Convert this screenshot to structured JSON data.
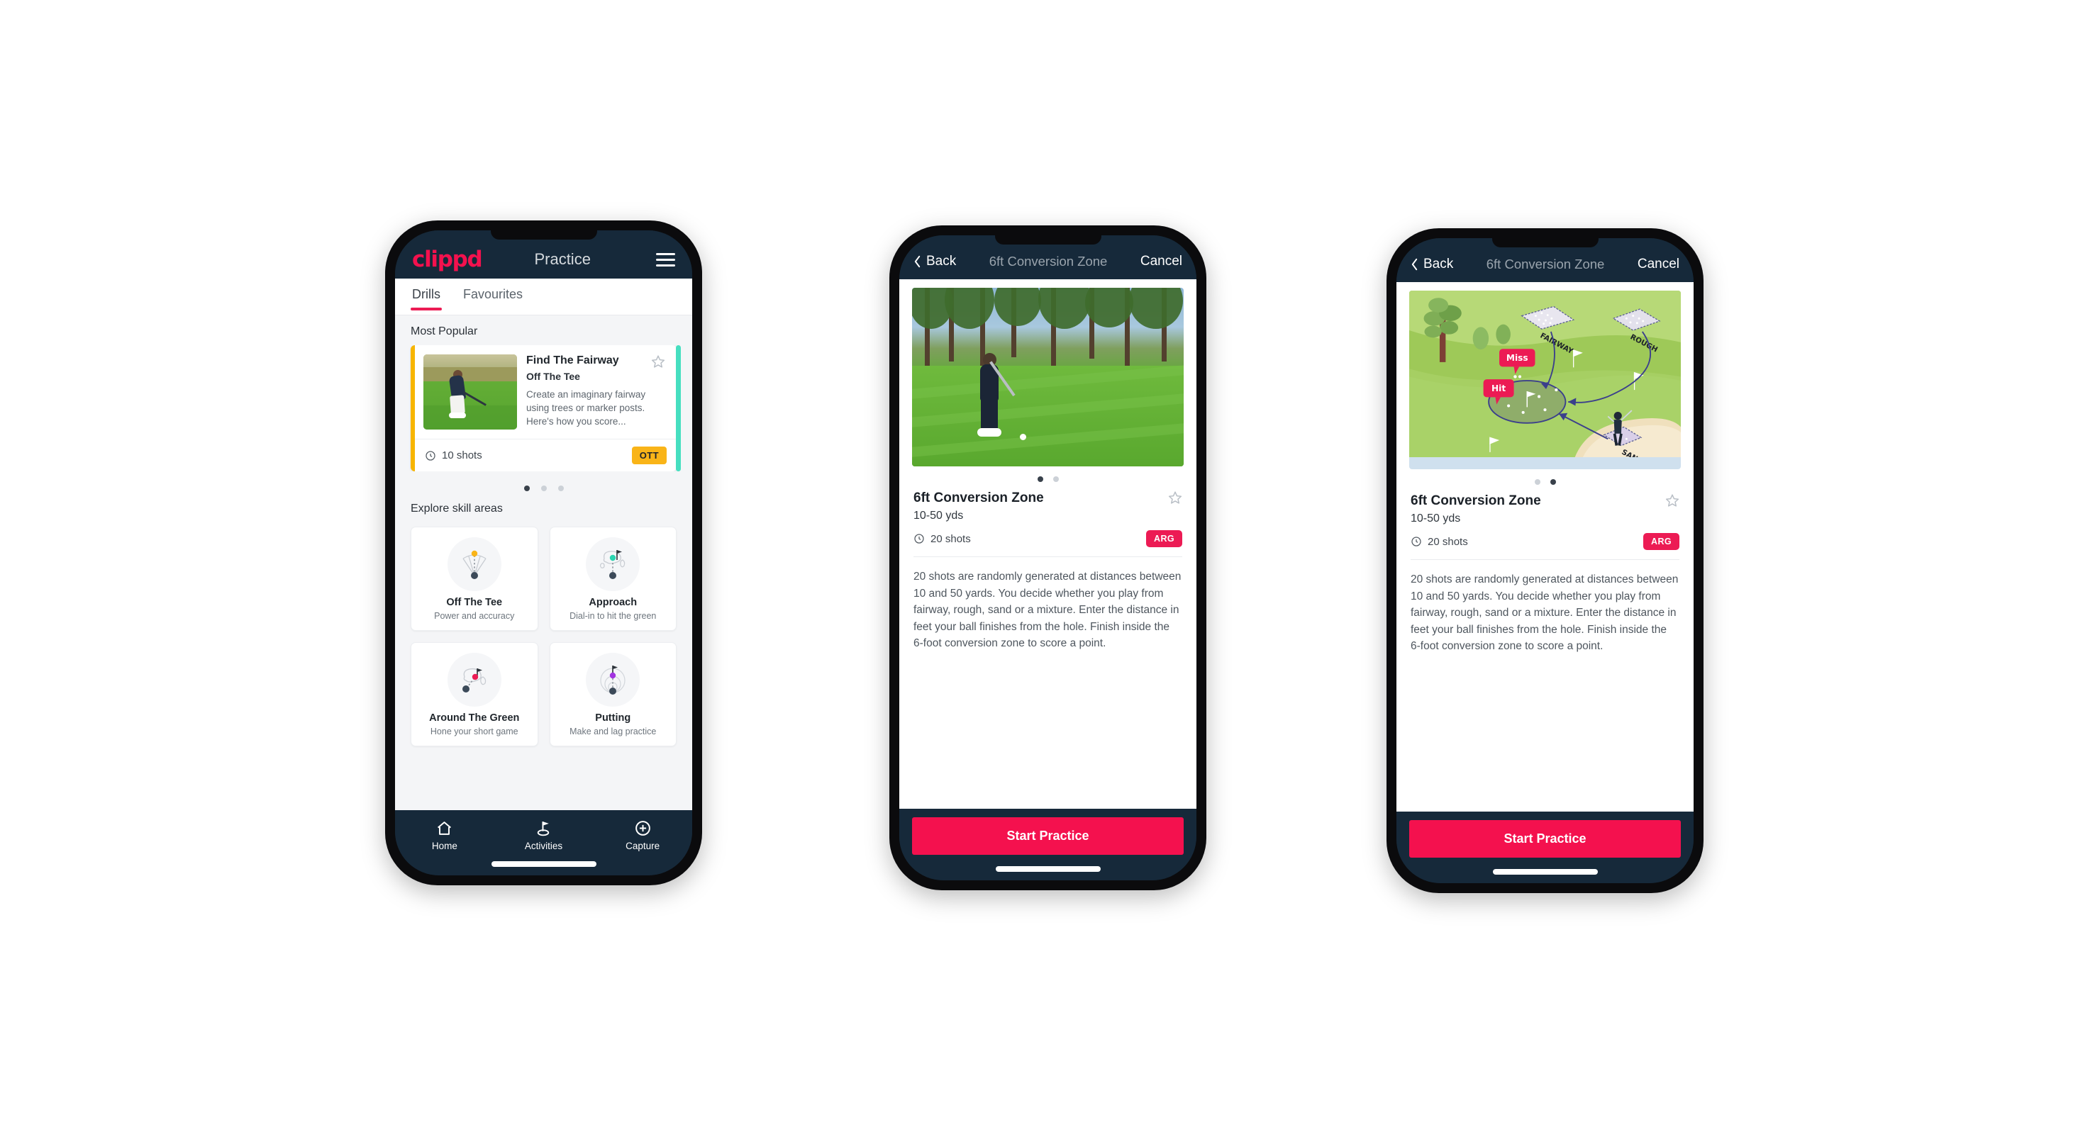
{
  "practice_screen": {
    "logo_text": "clippd",
    "header_title": "Practice",
    "menu_icon": "hamburger-menu-icon",
    "tabs": [
      {
        "label": "Drills",
        "active": true
      },
      {
        "label": "Favourites",
        "active": false
      }
    ],
    "most_popular_label": "Most Popular",
    "featured_drill": {
      "title": "Find The Fairway",
      "subtitle": "Off The Tee",
      "description": "Create an imaginary fairway using trees or marker posts. Here's how you score...",
      "shots_text": "10 shots",
      "badge": "OTT",
      "badge_color": "#f9b418",
      "accent_color": "#f7b500",
      "next_card_accent": "#46dfc0",
      "star_icon": "star-outline-icon",
      "clock_icon": "clock-icon"
    },
    "carousel_dots": {
      "count": 3,
      "active_index": 0
    },
    "explore_label": "Explore skill areas",
    "skill_areas": [
      {
        "name": "Off The Tee",
        "desc": "Power and accuracy",
        "icon": "tee-dispersion-icon",
        "dot_color": "#f9b418"
      },
      {
        "name": "Approach",
        "desc": "Dial-in to hit the green",
        "icon": "approach-green-icon",
        "dot_color": "#2ad4b0"
      },
      {
        "name": "Around The Green",
        "desc": "Hone your short game",
        "icon": "around-green-icon",
        "dot_color": "#ec1b54"
      },
      {
        "name": "Putting",
        "desc": "Make and lag practice",
        "icon": "putting-rings-icon",
        "dot_color": "#a335e0"
      }
    ],
    "bottom_nav": [
      {
        "label": "Home",
        "icon": "home-icon",
        "active": false
      },
      {
        "label": "Activities",
        "icon": "golf-flag-icon",
        "active": true
      },
      {
        "label": "Capture",
        "icon": "plus-circle-icon",
        "active": false
      }
    ]
  },
  "detail_screen": {
    "header": {
      "back_label": "Back",
      "back_icon": "chevron-left-icon",
      "title": "6ft Conversion Zone",
      "cancel_label": "Cancel"
    },
    "title": "6ft Conversion Zone",
    "distance": "10-50 yds",
    "shots_text": "20 shots",
    "shots_icon": "clock-icon",
    "badge": "ARG",
    "badge_color": "#ec1b54",
    "star_icon": "star-outline-icon",
    "description": "20 shots are randomly generated at distances between 10 and 50 yards. You decide whether you play from fairway, rough, sand or a mixture. Enter the distance in feet your ball finishes from the hole. Finish inside the 6-foot conversion zone to score a point.",
    "cta_label": "Start Practice",
    "cta_color": "#f4114e",
    "variant_a": {
      "media_type": "photo",
      "media_description": "golfer chipping on green with pine trees",
      "carousel_dots": {
        "count": 2,
        "active_index": 0
      }
    },
    "variant_b": {
      "media_type": "illustration",
      "media_description": "isometric golf course diagram",
      "carousel_dots": {
        "count": 2,
        "active_index": 1
      },
      "diagram_labels": {
        "fairway": "FAIRWAY",
        "rough": "ROUGH",
        "sand": "SAND",
        "miss_pin": "Miss",
        "hit_pin": "Hit"
      }
    }
  },
  "theme": {
    "brand_pink": "#f4114e",
    "header_navy": "#16293a",
    "page_background": "#ffffff",
    "app_background": "#f4f5f7"
  }
}
